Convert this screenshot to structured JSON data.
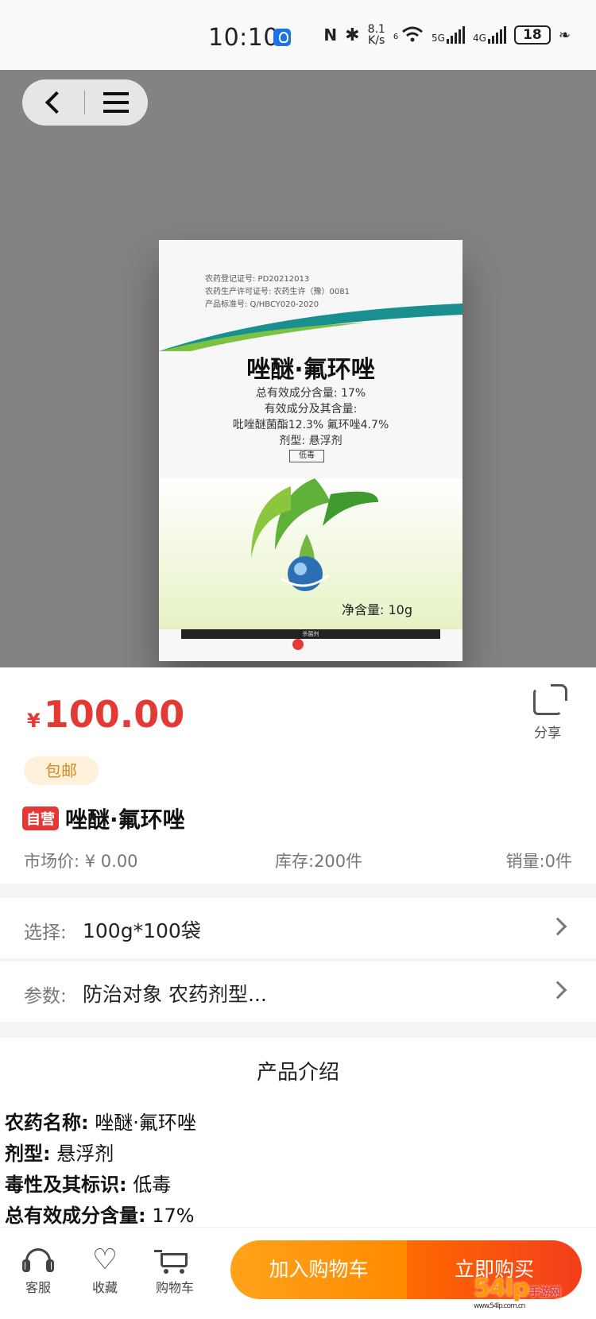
{
  "status_bar": {
    "time": "10:10",
    "speed_value": "8.1",
    "speed_unit": "K/s",
    "wifi_label": "6",
    "net1": "5G",
    "net2": "4G",
    "battery": "18"
  },
  "gallery": {
    "package": {
      "reg_no": "农药登记证号: PD20212013",
      "prod_license": "农药生产许可证号: 农药生许（豫）0081",
      "standard": "产品标准号: Q/HBCY020-2020",
      "name": "唑醚·氟环唑",
      "total": "总有效成分含量: 17%",
      "components_title": "有效成分及其含量:",
      "components": "吡唑醚菌酯12.3%   氟环唑4.7%",
      "form": "剂型: 悬浮剂",
      "toxicity": "低毒",
      "net_weight": "净含量: 10g",
      "category": "杀菌剂"
    }
  },
  "product": {
    "currency": "¥",
    "price": "100.00",
    "share_label": "分享",
    "shipping_badge": "包邮",
    "self_tag": "自营",
    "title": "唑醚·氟环唑",
    "market_price": "市场价: ¥ 0.00",
    "stock": "库存:200件",
    "sales": "销量:0件"
  },
  "options": {
    "select_label": "选择:",
    "select_value": "100g*100袋",
    "params_label": "参数:",
    "params_value": "防治对象   农药剂型..."
  },
  "intro": {
    "heading": "产品介绍",
    "lines": [
      {
        "k": "农药名称:",
        "v": "唑醚·氟环唑"
      },
      {
        "k": "剂型:",
        "v": "悬浮剂"
      },
      {
        "k": "毒性及其标识:",
        "v": "低毒"
      },
      {
        "k": "总有效成分含量:",
        "v": "17%"
      }
    ]
  },
  "bottom_bar": {
    "service": "客服",
    "favorite": "收藏",
    "cart": "购物车",
    "add_to_cart": "加入购物车",
    "buy_now": "立即购买"
  },
  "watermark": {
    "main": "54lp",
    "sub": "手游网",
    "site": "www.54lp.com.cn"
  },
  "colors": {
    "accent": "#e53935",
    "orange": "#ff8a00",
    "gallery_bg": "#838383"
  }
}
